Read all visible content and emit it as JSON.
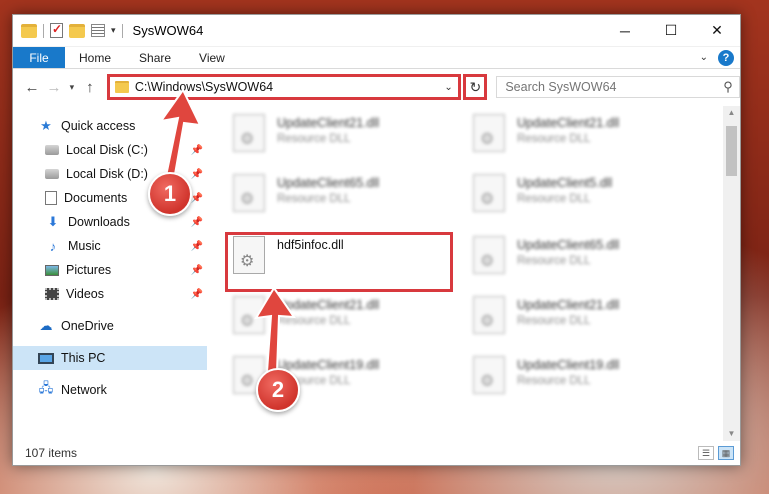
{
  "window": {
    "title": "SysWOW64",
    "controls": {
      "minimize": "─",
      "maximize": "☐",
      "close": "✕"
    }
  },
  "ribbon": {
    "tabs": [
      "File",
      "Home",
      "Share",
      "View"
    ],
    "help": "?"
  },
  "nav": {
    "back": "←",
    "forward": "→",
    "recent": "⌄",
    "up": "↑",
    "address": "C:\\Windows\\SysWOW64",
    "refresh": "↻",
    "search_placeholder": "Search SysWOW64",
    "search_icon": "search-icon"
  },
  "sidebar": {
    "items": [
      {
        "label": "Quick access",
        "icon": "star-icon",
        "pinned": false
      },
      {
        "label": "Local Disk (C:)",
        "icon": "disk-icon",
        "pinned": true
      },
      {
        "label": "Local Disk (D:)",
        "icon": "disk-icon",
        "pinned": true
      },
      {
        "label": "Documents",
        "icon": "documents-icon",
        "pinned": true
      },
      {
        "label": "Downloads",
        "icon": "downloads-icon",
        "pinned": true
      },
      {
        "label": "Music",
        "icon": "music-icon",
        "pinned": true
      },
      {
        "label": "Pictures",
        "icon": "pictures-icon",
        "pinned": true
      },
      {
        "label": "Videos",
        "icon": "videos-icon",
        "pinned": true
      },
      {
        "label": "OneDrive",
        "icon": "onedrive-icon",
        "pinned": false
      },
      {
        "label": "This PC",
        "icon": "pc-icon",
        "pinned": false,
        "selected": true
      },
      {
        "label": "Network",
        "icon": "network-icon",
        "pinned": false
      }
    ]
  },
  "files": {
    "left": [
      {
        "name": "UpdateClient21.dll",
        "type": "Resource DLL"
      },
      {
        "name": "UpdateClient65.dll",
        "type": "Resource DLL"
      },
      {
        "name": "hdf5infoc.dll",
        "type": ""
      },
      {
        "name": "UpdateClient21.dll",
        "type": "Resource DLL"
      },
      {
        "name": "UpdateClient19.dll",
        "type": "Resource DLL"
      }
    ],
    "right": [
      {
        "name": "UpdateClient21.dll",
        "type": "Resource DLL"
      },
      {
        "name": "UpdateClient5.dll",
        "type": "Resource DLL"
      },
      {
        "name": "UpdateClient65.dll",
        "type": "Resource DLL"
      },
      {
        "name": "UpdateClient21.dll",
        "type": "Resource DLL"
      },
      {
        "name": "UpdateClient19.dll",
        "type": "Resource DLL"
      }
    ]
  },
  "status": {
    "count": "107 items"
  },
  "annotations": {
    "step1": "1",
    "step2": "2",
    "color": "#d8393e"
  }
}
